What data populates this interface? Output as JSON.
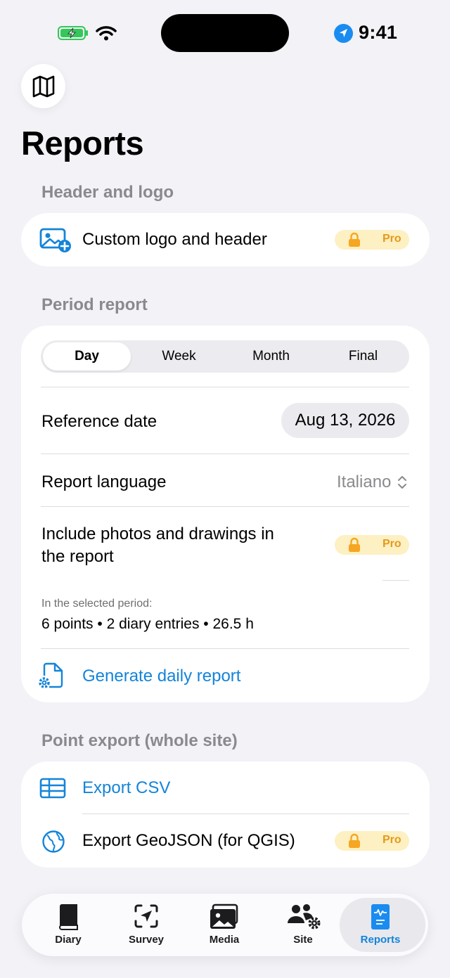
{
  "status_bar": {
    "time": "9:41"
  },
  "title": "Reports",
  "header_section": {
    "label": "Header and logo",
    "custom_logo": "Custom logo and header",
    "pro_badge": "Pro"
  },
  "period_section": {
    "label": "Period report",
    "segments": [
      "Day",
      "Week",
      "Month",
      "Final"
    ],
    "selected_segment": "Day",
    "reference_date_label": "Reference date",
    "reference_date_value": "Aug 13, 2026",
    "language_label": "Report language",
    "language_value": "Italiano",
    "include_photos_line1": "Include photos and drawings in",
    "include_photos_line2": "the report",
    "pro_badge": "Pro",
    "summary_caption": "In the selected period:",
    "summary_text": "6 points • 2 diary entries • 26.5 h",
    "generate": "Generate daily report"
  },
  "export_section": {
    "label": "Point export (whole site)",
    "csv": "Export CSV",
    "geojson": "Export GeoJSON (for QGIS)",
    "pro_badge": "Pro"
  },
  "tabs": [
    {
      "label": "Diary",
      "icon": "book-icon"
    },
    {
      "label": "Survey",
      "icon": "survey-viewfinder-icon"
    },
    {
      "label": "Media",
      "icon": "photos-icon"
    },
    {
      "label": "Site",
      "icon": "people-gear-icon"
    },
    {
      "label": "Reports",
      "icon": "report-document-icon"
    }
  ],
  "colors": {
    "accent": "#1484d9",
    "pro_bg": "#fdf0c2",
    "pro_fg": "#e39a1b",
    "background": "#f2f2f7"
  }
}
